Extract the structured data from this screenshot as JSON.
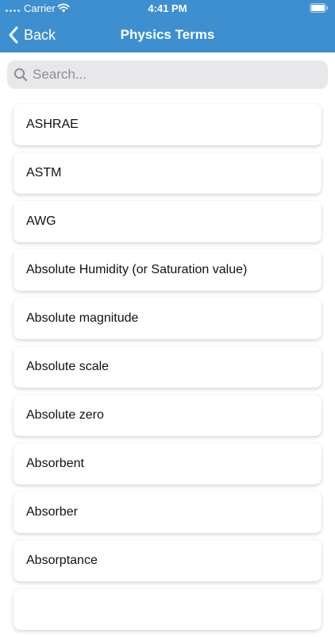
{
  "status_bar": {
    "carrier": "Carrier",
    "time": "4:41 PM"
  },
  "nav": {
    "back_label": "Back",
    "title": "Physics Terms"
  },
  "search": {
    "placeholder": "Search...",
    "value": ""
  },
  "terms": [
    {
      "label": "ASHRAE"
    },
    {
      "label": "ASTM"
    },
    {
      "label": "AWG"
    },
    {
      "label": "Absolute Humidity (or Saturation value)"
    },
    {
      "label": "Absolute magnitude"
    },
    {
      "label": "Absolute scale"
    },
    {
      "label": "Absolute zero"
    },
    {
      "label": "Absorbent"
    },
    {
      "label": "Absorber"
    },
    {
      "label": "Absorptance"
    }
  ],
  "colors": {
    "header_bg": "#3d8fd0",
    "search_bg": "#e8e8ea"
  }
}
